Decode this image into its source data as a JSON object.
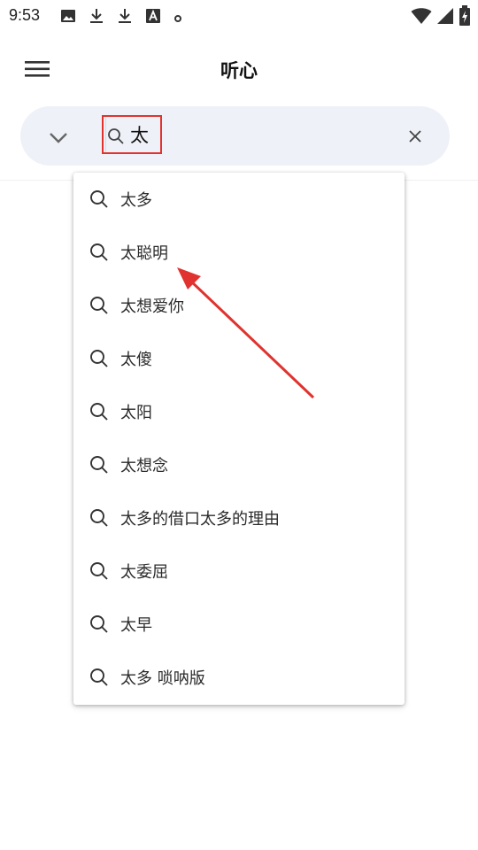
{
  "status_bar": {
    "time": "9:53",
    "left_icons": [
      "image-icon",
      "download-icon",
      "download-icon",
      "font-a-icon",
      "dot-icon"
    ],
    "right_icons": [
      "wifi-icon",
      "cell-signal-icon",
      "battery-charging-icon"
    ]
  },
  "app_bar": {
    "title": "听心",
    "menu_icon": "hamburger-menu-icon"
  },
  "search": {
    "query": "太",
    "dropdown_icon": "chevron-down-icon",
    "search_icon": "search-icon",
    "clear_icon": "close-icon"
  },
  "suggestions": [
    {
      "label": "太多"
    },
    {
      "label": "太聪明"
    },
    {
      "label": "太想爱你"
    },
    {
      "label": "太傻"
    },
    {
      "label": "太阳"
    },
    {
      "label": "太想念"
    },
    {
      "label": "太多的借口太多的理由"
    },
    {
      "label": "太委屈"
    },
    {
      "label": "太早"
    },
    {
      "label": "太多 唢呐版"
    }
  ],
  "colors": {
    "annotation_red": "#e0332f",
    "search_bar_bg": "#eef1f7"
  }
}
